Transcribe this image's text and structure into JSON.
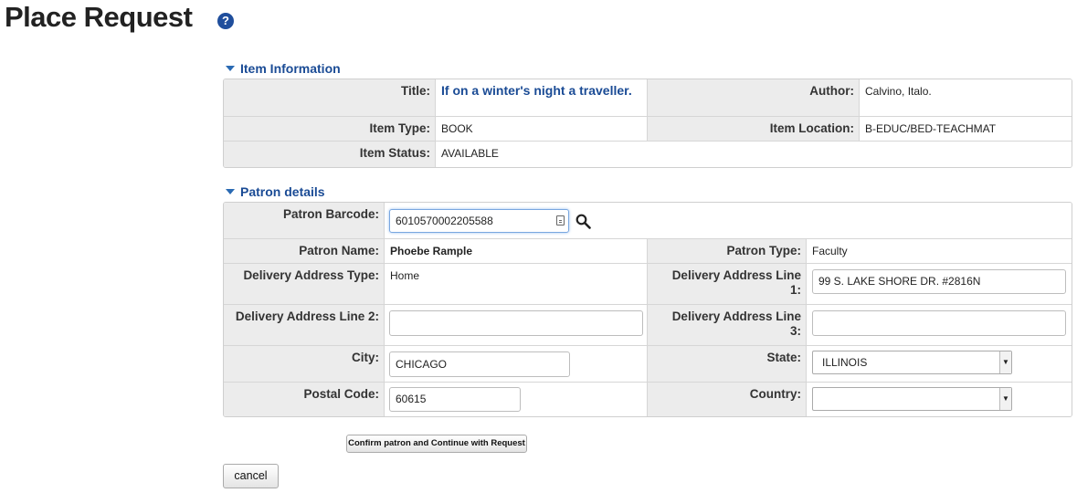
{
  "page": {
    "title": "Place Request",
    "help_icon": "?"
  },
  "item_section": {
    "heading": "Item Information",
    "title_label": "Title:",
    "title_value": "If on a winter's night a traveller.",
    "author_label": "Author:",
    "author_value": "Calvino, Italo.",
    "item_type_label": "Item Type:",
    "item_type_value": "BOOK",
    "item_location_label": "Item Location:",
    "item_location_value": "B-EDUC/BED-TEACHMAT",
    "item_status_label": "Item Status:",
    "item_status_value": "AVAILABLE"
  },
  "patron_section": {
    "heading": "Patron details",
    "barcode_label": "Patron Barcode:",
    "barcode_value": "6010570002205588",
    "name_label": "Patron Name:",
    "name_value": "Phoebe Rample",
    "type_label": "Patron Type:",
    "type_value": "Faculty",
    "delivery_type_label": "Delivery Address Type:",
    "delivery_type_value": "Home",
    "line1_label_a": "Delivery Address Line",
    "line1_label_b": "1:",
    "line1_value": "99 S. LAKE SHORE DR. #2816N",
    "line2_label": "Delivery Address Line 2:",
    "line2_value": "",
    "line3_label_a": "Delivery Address Line",
    "line3_label_b": "3:",
    "line3_value": "",
    "city_label": "City:",
    "city_value": "CHICAGO",
    "state_label": "State:",
    "state_value": "ILLINOIS",
    "postal_label": "Postal Code:",
    "postal_value": "60615",
    "country_label": "Country:",
    "country_value": ""
  },
  "actions": {
    "confirm_label": "Confirm patron and Continue with Request",
    "cancel_label": "cancel"
  },
  "colors": {
    "heading_blue": "#1a4b95",
    "label_bg": "#ececec",
    "focus_border": "#79a7e0"
  },
  "icons": {
    "help": "help-icon",
    "search": "search-icon",
    "card": "id-card-icon",
    "collapse": "triangle-down-icon"
  }
}
